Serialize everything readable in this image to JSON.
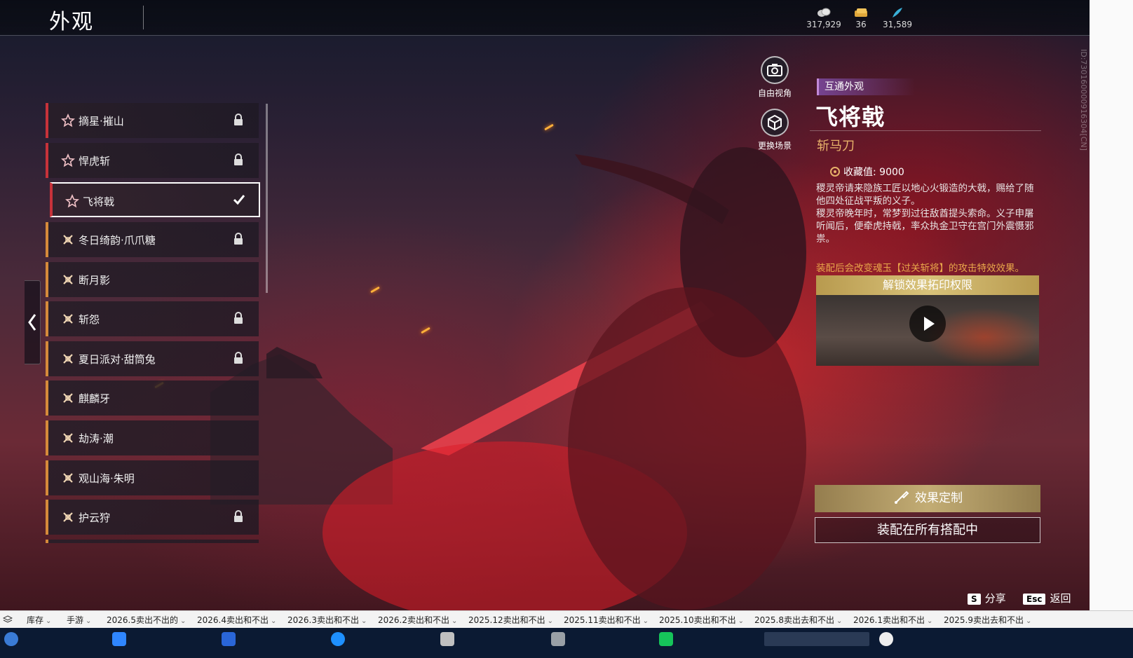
{
  "header": {
    "title": "外观"
  },
  "currencies": [
    {
      "icon": "coins-icon",
      "value": "317,929"
    },
    {
      "icon": "ticket-icon",
      "value": "36"
    },
    {
      "icon": "feather-icon",
      "value": "31,589"
    }
  ],
  "side_id": "ID:730160000916304[CN]",
  "appearance_list": [
    {
      "label": "摘星·摧山",
      "tier": "red",
      "icon": "star-icon",
      "locked": true
    },
    {
      "label": "悍虎斩",
      "tier": "red",
      "icon": "star-icon",
      "locked": true
    },
    {
      "label": "飞将戟",
      "tier": "red",
      "icon": "star-icon",
      "selected": true
    },
    {
      "label": "冬日绮韵·爪爪糖",
      "tier": "orange",
      "icon": "cross-icon",
      "locked": true
    },
    {
      "label": "断月影",
      "tier": "orange",
      "icon": "cross-icon",
      "locked": false
    },
    {
      "label": "斩怨",
      "tier": "orange",
      "icon": "cross-icon",
      "locked": true
    },
    {
      "label": "夏日派对·甜筒兔",
      "tier": "orange",
      "icon": "cross-icon",
      "locked": true
    },
    {
      "label": "麒麟牙",
      "tier": "orange",
      "icon": "cross-icon",
      "locked": false
    },
    {
      "label": "劫涛·潮",
      "tier": "orange",
      "icon": "cross-icon",
      "locked": false
    },
    {
      "label": "观山海·朱明",
      "tier": "orange",
      "icon": "cross-icon",
      "locked": false
    },
    {
      "label": "护云狩",
      "tier": "orange",
      "icon": "cross-icon",
      "locked": true
    }
  ],
  "camera_tools": {
    "free_view": "自由视角",
    "change_scene": "更换场景"
  },
  "detail": {
    "tag": "互通外观",
    "name": "飞将戟",
    "weapon_type": "斩马刀",
    "collect_label": "收藏值: 9000",
    "description": [
      "稷灵帝请来隐族工匠以地心火锻造的大戟，赐给了随他四处征战平叛的义子。",
      "稷灵帝晚年时，常梦到过往敌酋提头索命。义子申屠听闻后，便牵虎持戟，率众执金卫守在宫门外震慑邪祟。"
    ],
    "effect_note": "装配后会改变魂玉【过关斩将】的攻击特效效果。",
    "unlock_label": "解锁效果拓印权限",
    "customize_label": "效果定制",
    "equip_label": "装配在所有搭配中"
  },
  "hints": {
    "share_key": "S",
    "share_label": "分享",
    "back_key": "Esc",
    "back_label": "返回"
  },
  "bookmarks": [
    "库存",
    "手游",
    "2026.5卖出不出的",
    "2026.4卖出和不出",
    "2026.3卖出和不出",
    "2026.2卖出和不出",
    "2025.12卖出和不出",
    "2025.11卖出和不出",
    "2025.10卖出和不出",
    "2025.8卖出去和不出",
    "2026.1卖出和不出",
    "2025.9卖出去和不出"
  ],
  "colors": {
    "red_tier": "#c7323a",
    "orange_tier": "#d68a3a",
    "gold": "#e7b16a",
    "tag_purple": "#c28ad8"
  }
}
